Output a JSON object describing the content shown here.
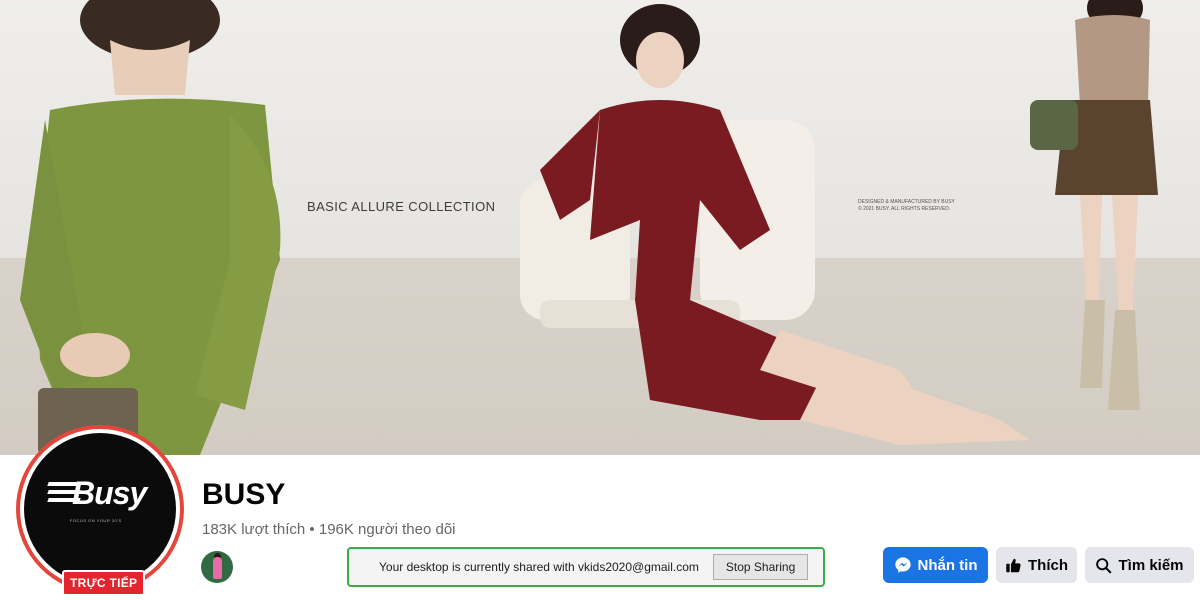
{
  "cover": {
    "collection_text": "BASIC ALLURE COLLECTION",
    "credit_line_1": "DESIGNED & MANUFACTURED BY BUSY",
    "credit_line_2": "© 2021 BUSY. All rights reserved."
  },
  "profile": {
    "logo_text": "Busy",
    "logo_tagline": "FOCUS ON YOUR 20'S",
    "live_badge": "TRỰC TIẾP",
    "page_name": "BUSY",
    "stats": "183K lượt thích • 196K người theo dõi"
  },
  "screen_share": {
    "message": "Your desktop is currently shared with vkids2020@gmail.com",
    "stop_label": "Stop Sharing"
  },
  "actions": {
    "message_label": "Nhắn tin",
    "like_label": "Thích",
    "search_label": "Tìm kiếm"
  },
  "colors": {
    "primary_blue": "#1b74e4",
    "live_red": "#e4242f",
    "share_border_green": "#3aad4a"
  },
  "icons": {
    "message": "messenger-icon",
    "like": "thumbs-up-icon",
    "search": "search-icon"
  }
}
